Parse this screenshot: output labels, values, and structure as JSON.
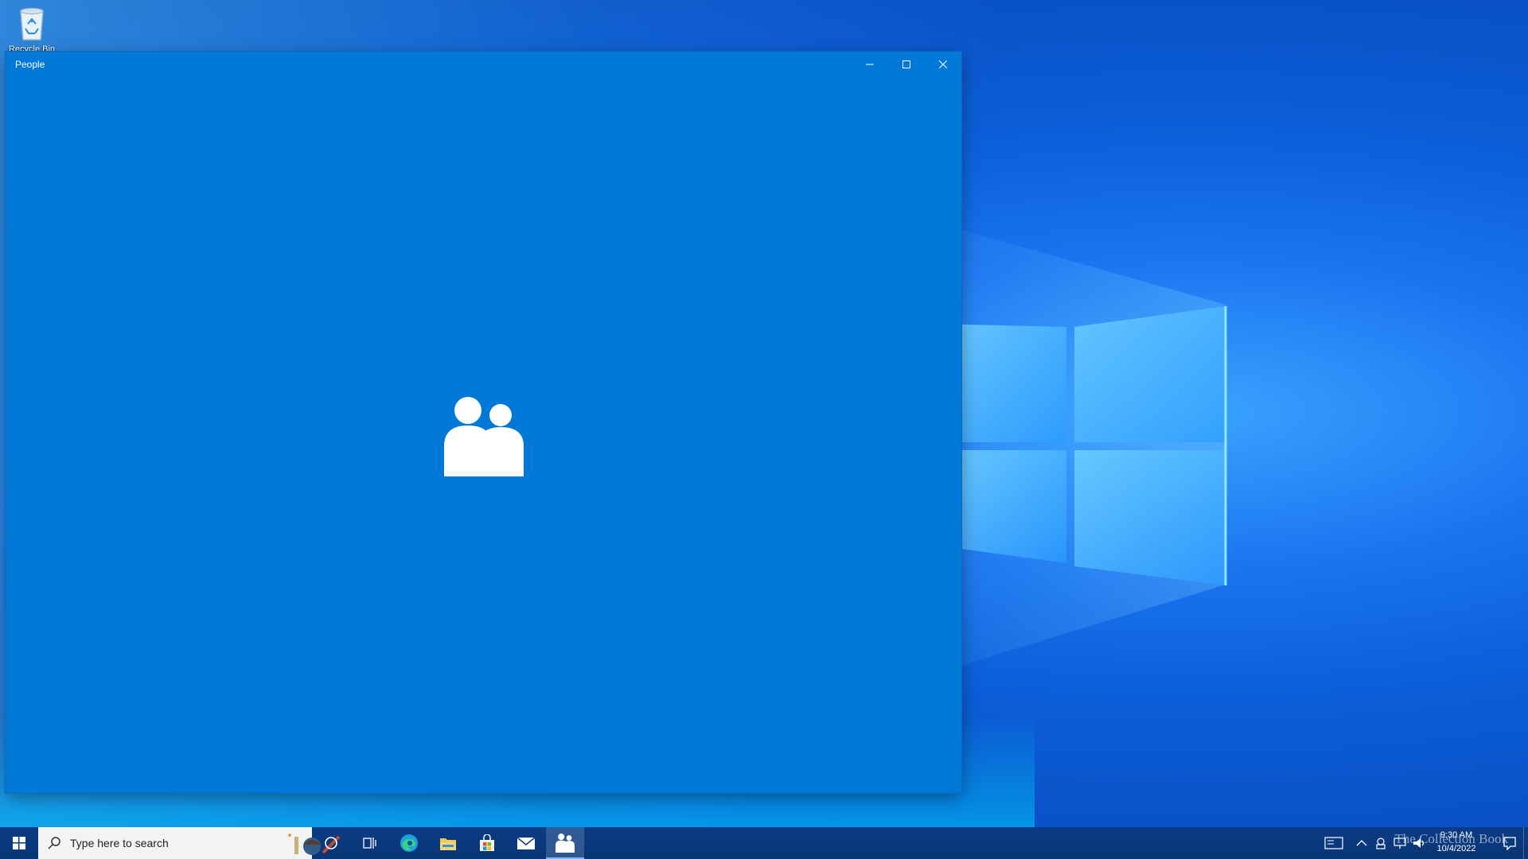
{
  "desktop": {
    "recycle_bin_label": "Recycle Bin"
  },
  "window": {
    "title": "People",
    "buttons": {
      "minimize": "minimize-icon",
      "maximize": "maximize-icon",
      "close": "close-icon"
    },
    "splash_icon": "people-icon",
    "background_color": "#0078d7"
  },
  "taskbar": {
    "search_placeholder": "Type here to search",
    "pinned": [
      "cortana-icon",
      "task-view-icon",
      "edge-icon",
      "file-explorer-icon",
      "store-icon",
      "mail-icon",
      "people-icon"
    ],
    "active_app": "People"
  },
  "tray": {
    "watermark": "The Collection Book",
    "time": "9:30 AM",
    "date": "10/4/2022"
  }
}
